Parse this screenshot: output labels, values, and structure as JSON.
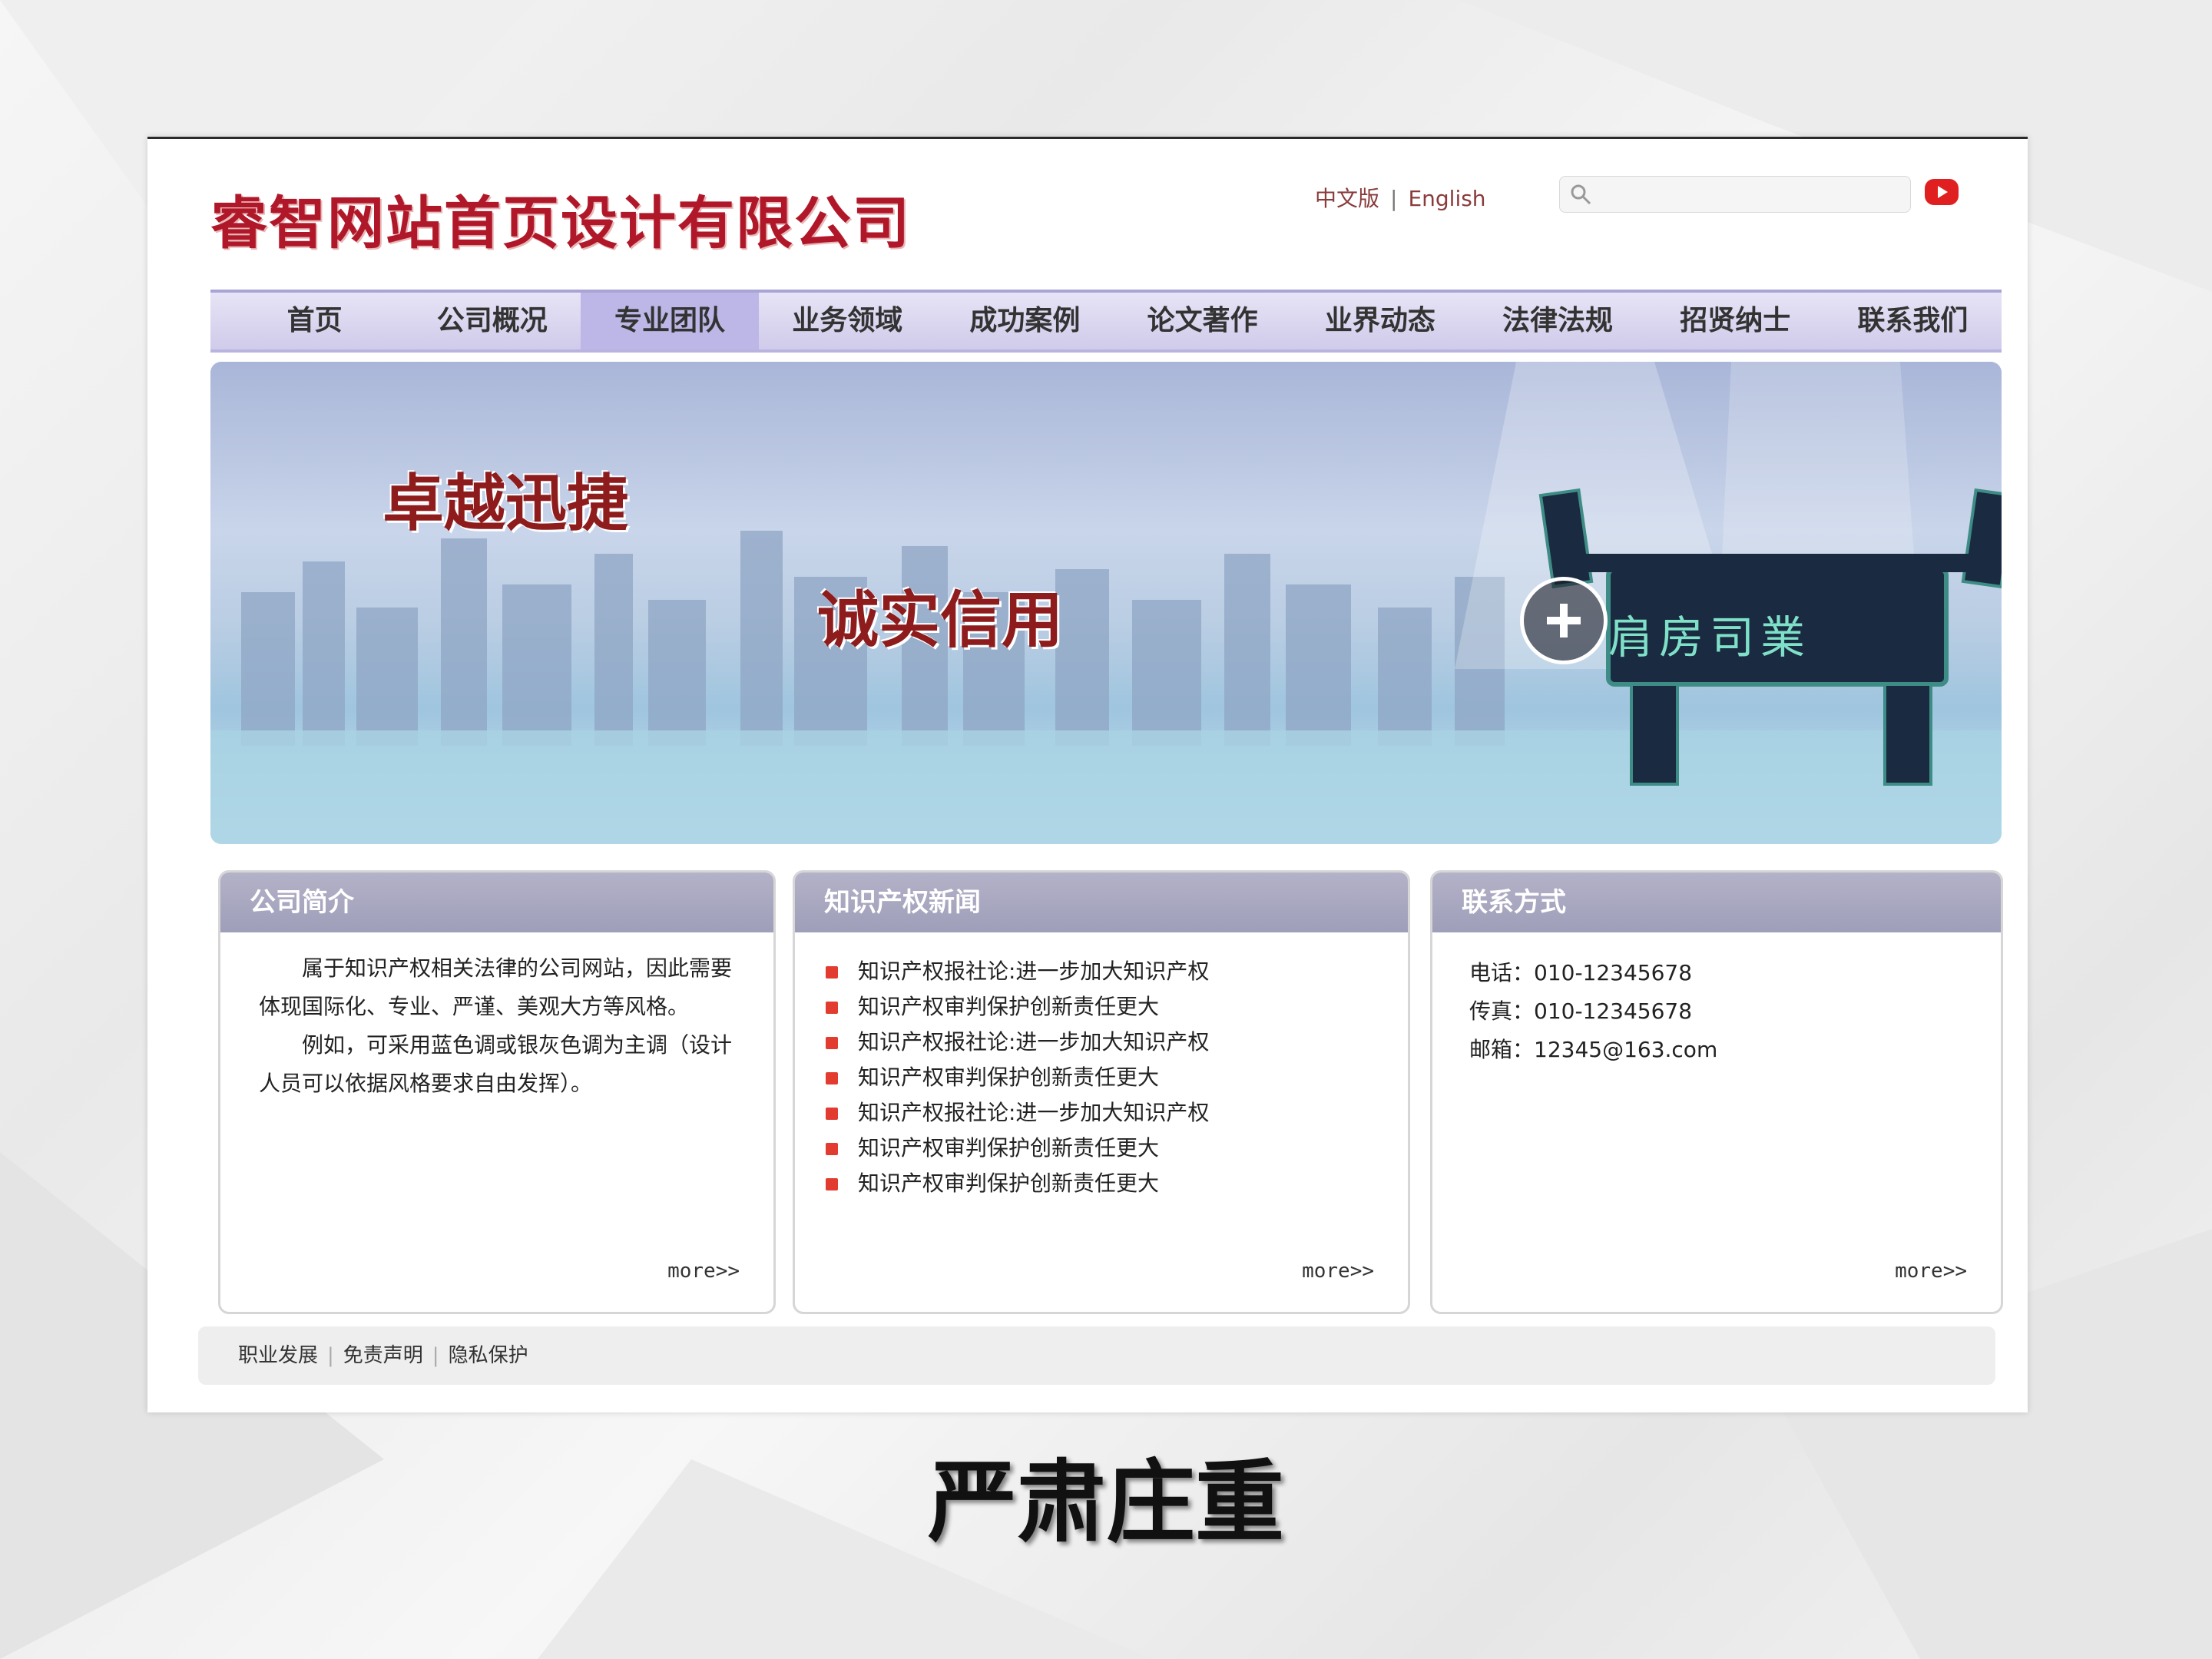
{
  "site": {
    "title": "睿智网站首页设计有限公司",
    "lang_cn": "中文版",
    "lang_sep": "|",
    "lang_en": "English",
    "search_placeholder": ""
  },
  "nav": {
    "active_index": 2,
    "items": [
      "首页",
      "公司概况",
      "专业团队",
      "业务领域",
      "成功案例",
      "论文著作",
      "业界动态",
      "法律法规",
      "招贤纳士",
      "联系我们"
    ]
  },
  "banner": {
    "slogan_1": "卓越迅捷",
    "slogan_2": "诚实信用",
    "ding_text": "肩房司業"
  },
  "intro_panel": {
    "title": "公司简介",
    "para_1": "属于知识产权相关法律的公司网站，因此需要体现国际化、专业、严谨、美观大方等风格。",
    "para_2": "例如，可采用蓝色调或银灰色调为主调（设计人员可以依据风格要求自由发挥）。",
    "more": "more>>"
  },
  "news_panel": {
    "title": "知识产权新闻",
    "items": [
      "知识产权报社论:进一步加大知识产权",
      "知识产权审判保护创新责任更大",
      "知识产权报社论:进一步加大知识产权",
      "知识产权审判保护创新责任更大",
      "知识产权报社论:进一步加大知识产权",
      "知识产权审判保护创新责任更大",
      "知识产权审判保护创新责任更大"
    ],
    "more": "more>>"
  },
  "contact_panel": {
    "title": "联系方式",
    "phone": "电话：010-12345678",
    "fax": "传真：010-12345678",
    "email": "邮箱：12345@163.com",
    "more": "more>>"
  },
  "footer": {
    "links": [
      "职业发展",
      "免责声明",
      "隐私保护"
    ],
    "sep": "|"
  },
  "caption": "严肃庄重",
  "colors": {
    "brand_red": "#b0182a",
    "nav_bg": "#cfcbea",
    "panel_header": "#a7a6bf",
    "bullet_red": "#e23b2f"
  }
}
